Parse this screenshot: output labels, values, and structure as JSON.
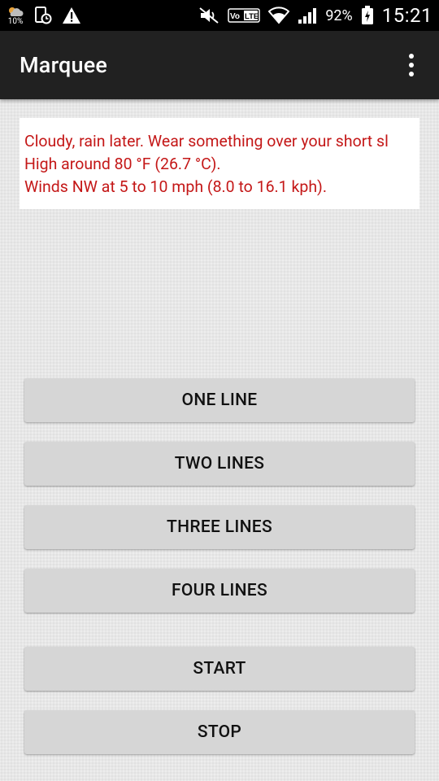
{
  "status_bar": {
    "weather_percent": "10%",
    "battery_percent": "92%",
    "volte_label": "VoLTE",
    "time": "15:21",
    "icons": [
      "weather-cloud-icon",
      "screenshot-clock-icon",
      "warning-icon",
      "mute-icon",
      "volte-icon",
      "wifi-icon",
      "signal-icon",
      "battery-icon"
    ]
  },
  "app_bar": {
    "title": "Marquee"
  },
  "marquee": {
    "lines": [
      "Cloudy, rain later. Wear something over your short sl",
      "High around 80 °F (26.7 °C).",
      "Winds NW at 5 to 10 mph (8.0 to 16.1 kph)."
    ],
    "text_color": "#c41717"
  },
  "buttons": {
    "one_line": "ONE LINE",
    "two_lines": "TWO LINES",
    "three_lines": "THREE LINES",
    "four_lines": "FOUR LINES",
    "start": "START",
    "stop": "STOP"
  }
}
